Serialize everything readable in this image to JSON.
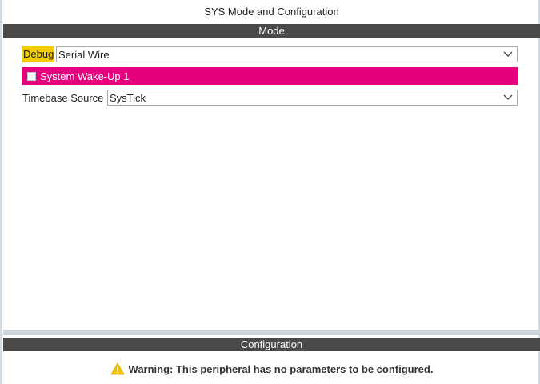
{
  "window": {
    "title": "SYS Mode and Configuration"
  },
  "mode_section": {
    "header": "Mode",
    "debug": {
      "label": "Debug",
      "selected_value": "Serial Wire"
    },
    "wakeup": {
      "label": "System Wake-Up 1",
      "checked": false,
      "highlight_color": "#e6007e"
    },
    "timebase": {
      "label": "Timebase Source",
      "selected_value": "SysTick"
    }
  },
  "config_section": {
    "header": "Configuration",
    "warning_text": "Warning: This peripheral has no parameters to be configured.",
    "warning_icon": "warning-triangle-icon"
  },
  "colors": {
    "header_bg": "#4a4a4a",
    "debug_highlight": "#f2cc00",
    "warning_icon": "#f2c200"
  }
}
